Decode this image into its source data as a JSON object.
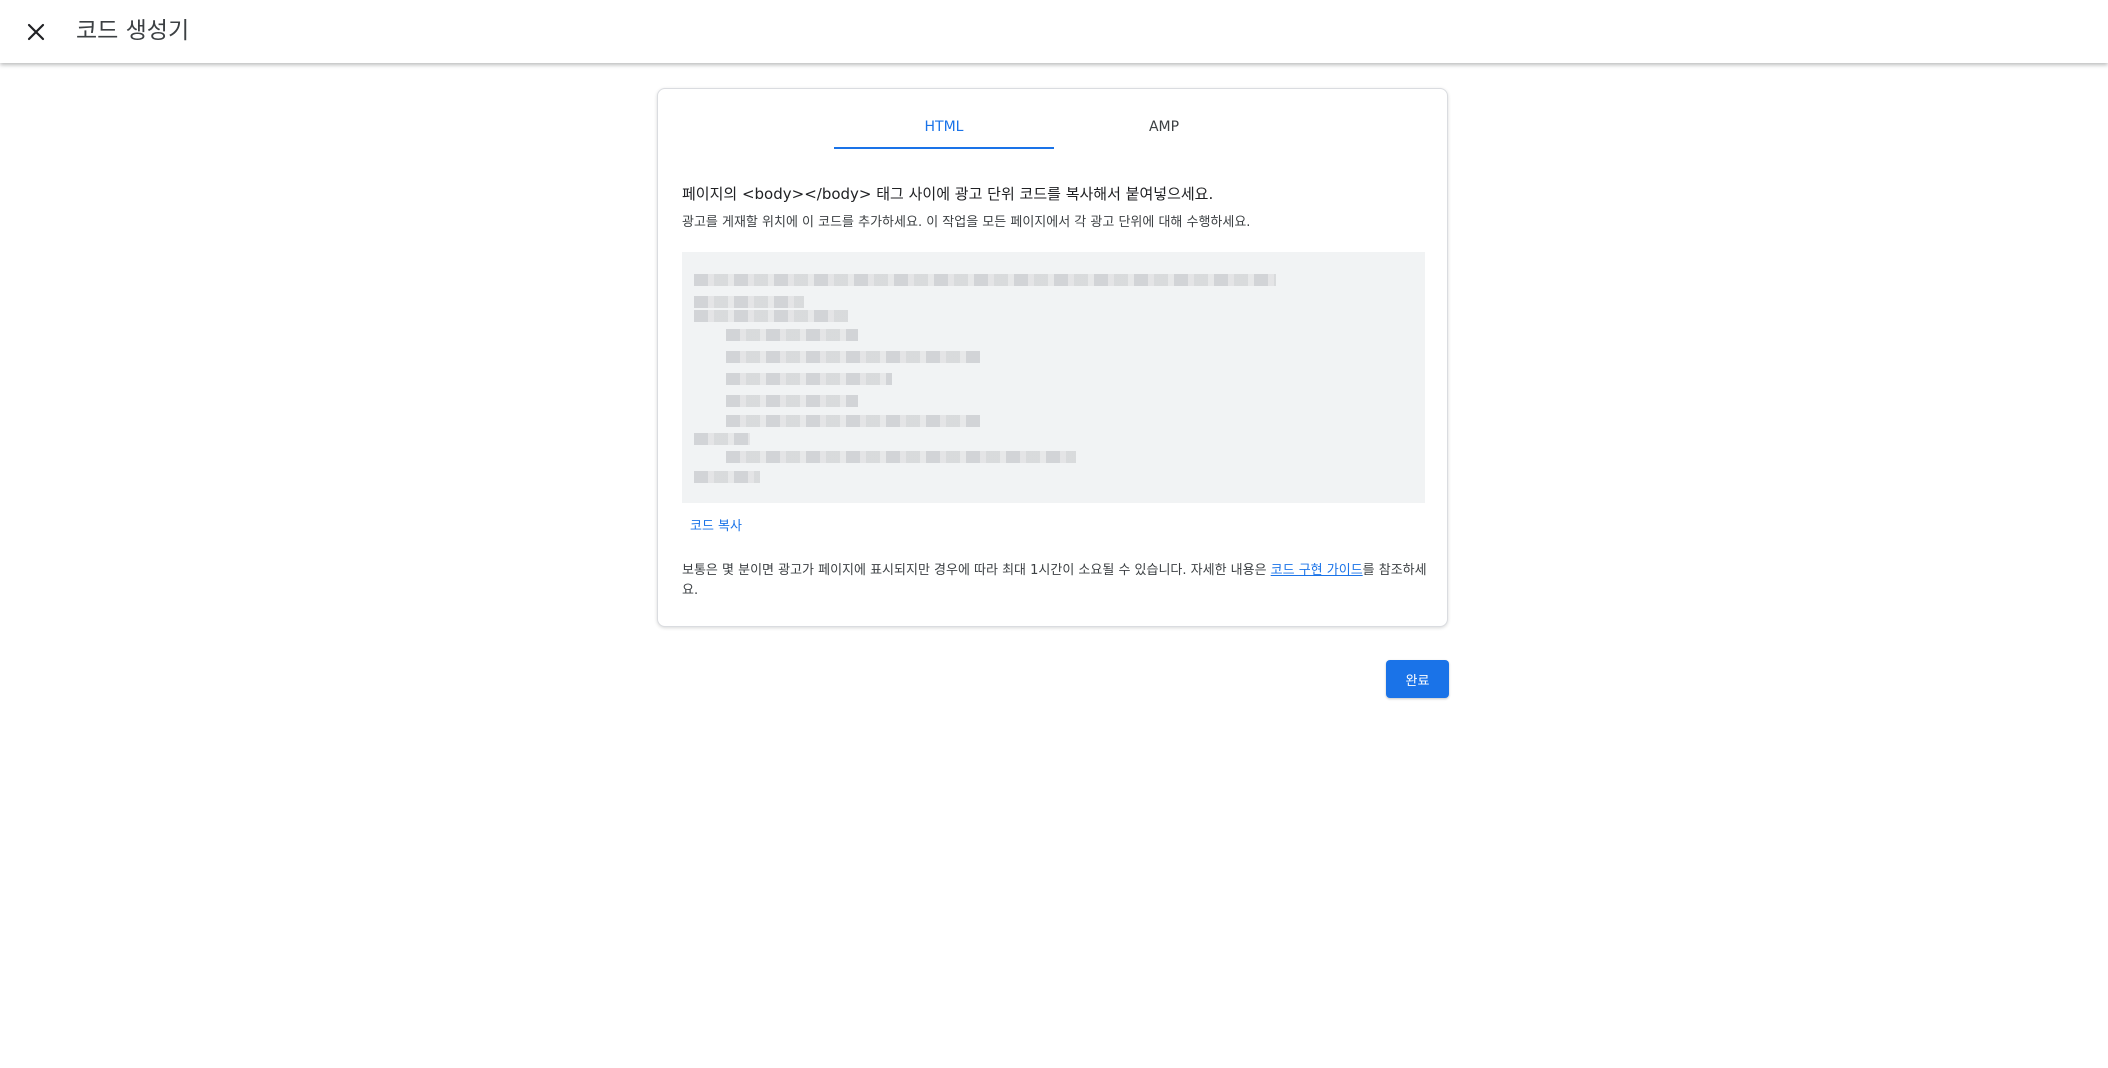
{
  "header": {
    "title": "코드 생성기",
    "close_icon": "close-icon"
  },
  "tabs": [
    {
      "label": "HTML",
      "selected": true
    },
    {
      "label": "AMP",
      "selected": false
    }
  ],
  "instructions": {
    "main": "페이지의 <body></body> 태그 사이에 광고 단위 코드를 복사해서 붙여넣으세요.",
    "sub": "광고를 게재할 위치에 이 코드를 추가하세요. 이 작업을 모든 페이지에서 각 광고 단위에 대해 수행하세요."
  },
  "code": {
    "copy_label": "코드 복사"
  },
  "note": {
    "text_before": "보통은 몇 분이면 광고가 페이지에 표시되지만 경우에 따라 최대 1시간이 소요될 수 있습니다. 자세한 내용은 ",
    "link_text": "코드 구현 가이드",
    "text_after": "를 참조하세요."
  },
  "actions": {
    "done_label": "완료"
  },
  "colors": {
    "accent": "#1a73e8",
    "code_background": "#f1f3f4"
  }
}
